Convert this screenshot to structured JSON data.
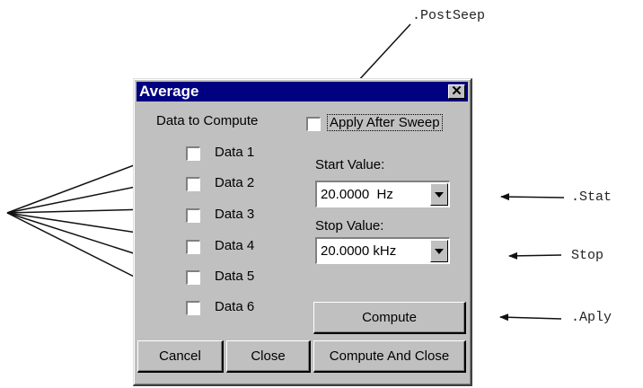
{
  "annotations": {
    "post_sweep": ".PostSeep",
    "start": ".Stat",
    "stop": "Stop",
    "apply": ".Aply"
  },
  "dialog": {
    "title": "Average",
    "close_glyph": "✕",
    "data_to_compute_label": "Data to Compute",
    "apply_after_sweep_label": "Apply After Sweep",
    "data_items": [
      {
        "label": "Data 1",
        "checked": false
      },
      {
        "label": "Data 2",
        "checked": false
      },
      {
        "label": "Data 3",
        "checked": false
      },
      {
        "label": "Data 4",
        "checked": false
      },
      {
        "label": "Data 5",
        "checked": false
      },
      {
        "label": "Data 6",
        "checked": false
      }
    ],
    "start_value_label": "Start Value:",
    "start_value": "20.0000  Hz",
    "stop_value_label": "Stop Value:",
    "stop_value": "20.0000 kHz",
    "buttons": {
      "compute": "Compute",
      "cancel": "Cancel",
      "close": "Close",
      "compute_and_close": "Compute And Close"
    }
  },
  "colors": {
    "dialog_face": "#c0c0c0",
    "titlebar": "#000080"
  }
}
